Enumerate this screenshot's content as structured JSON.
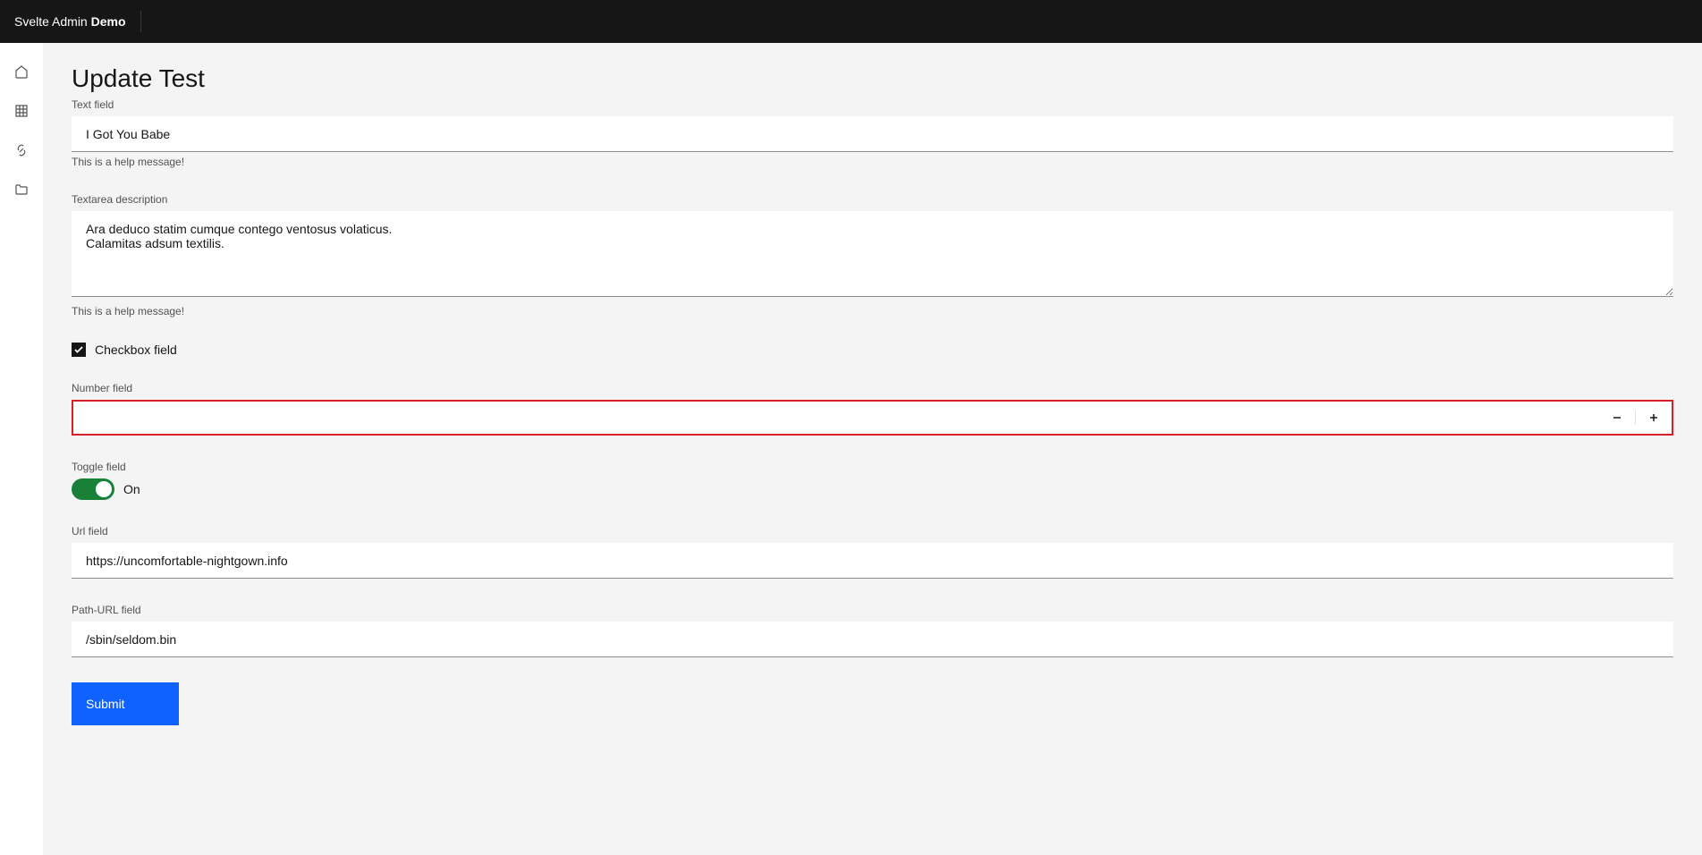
{
  "header": {
    "brand_prefix": "Svelte Admin ",
    "brand_suffix": "Demo"
  },
  "page": {
    "title": "Update Test"
  },
  "fields": {
    "text": {
      "label": "Text field",
      "value": "I Got You Babe",
      "help": "This is a help message!"
    },
    "textarea": {
      "label": "Textarea description",
      "value": "Ara deduco statim cumque contego ventosus volaticus.\nCalamitas adsum textilis.",
      "help": "This is a help message!"
    },
    "checkbox": {
      "label": "Checkbox field",
      "checked": true
    },
    "number": {
      "label": "Number field",
      "value": ""
    },
    "toggle": {
      "label": "Toggle field",
      "state_label": "On",
      "on": true
    },
    "url": {
      "label": "Url field",
      "value": "https://uncomfortable-nightgown.info"
    },
    "pathurl": {
      "label": "Path-URL field",
      "value": "/sbin/seldom.bin"
    }
  },
  "actions": {
    "submit_label": "Submit"
  }
}
